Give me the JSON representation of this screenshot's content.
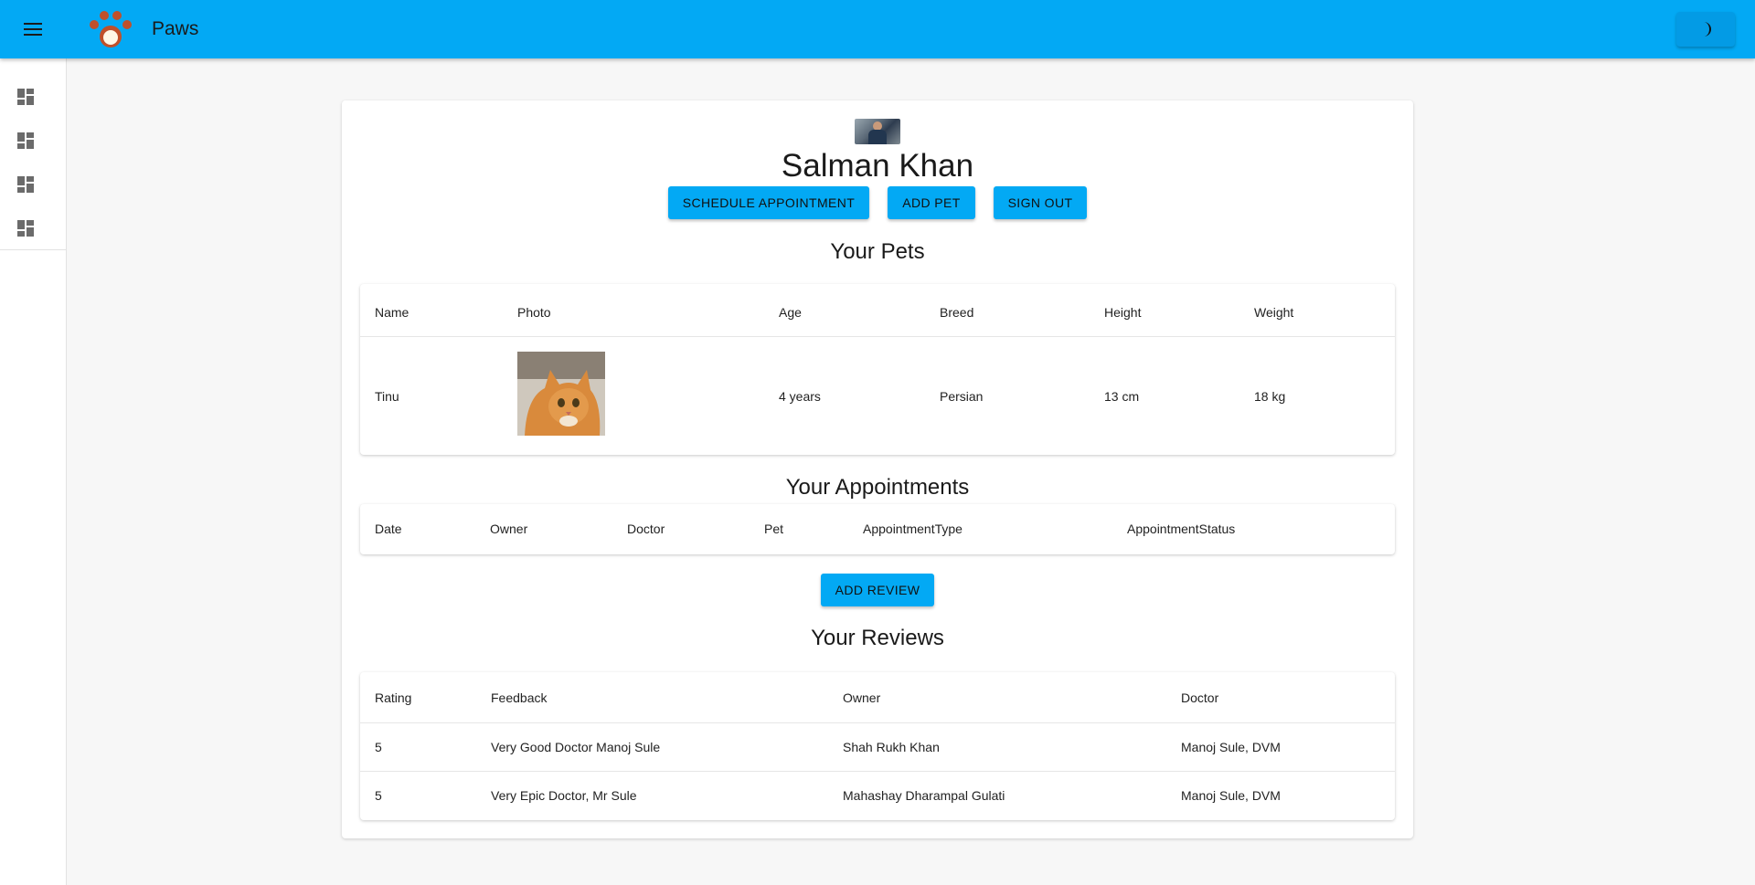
{
  "app": {
    "title": "Paws",
    "menu_icon": "hamburger-menu-icon",
    "theme_icon": "dark-mode-moon-icon"
  },
  "sidebar": {
    "items": [
      {
        "icon": "dashboard-icon"
      },
      {
        "icon": "dashboard-icon"
      },
      {
        "icon": "dashboard-icon"
      },
      {
        "icon": "dashboard-icon"
      }
    ]
  },
  "profile": {
    "name": "Salman Khan",
    "buttons": {
      "schedule": "SCHEDULE APPOINTMENT",
      "add_pet": "ADD PET",
      "sign_out": "SIGN OUT"
    }
  },
  "pets": {
    "title": "Your Pets",
    "headers": [
      "Name",
      "Photo",
      "Age",
      "Breed",
      "Height",
      "Weight"
    ],
    "rows": [
      {
        "name": "Tinu",
        "age": "4 years",
        "breed": "Persian",
        "height": "13 cm",
        "weight": "18 kg"
      }
    ]
  },
  "appointments": {
    "title": "Your Appointments",
    "headers": [
      "Date",
      "Owner",
      "Doctor",
      "Pet",
      "AppointmentType",
      "AppointmentStatus"
    ],
    "add_review_label": "ADD REVIEW"
  },
  "reviews": {
    "title": "Your Reviews",
    "headers": [
      "Rating",
      "Feedback",
      "Owner",
      "Doctor"
    ],
    "rows": [
      {
        "rating": "5",
        "feedback": "Very Good Doctor Manoj Sule",
        "owner": "Shah Rukh Khan",
        "doctor": "Manoj Sule, DVM"
      },
      {
        "rating": "5",
        "feedback": "Very Epic Doctor, Mr Sule",
        "owner": "Mahashay Dharampal Gulati",
        "doctor": "Manoj Sule, DVM"
      }
    ]
  },
  "colors": {
    "primary": "#03a9f4",
    "logo_paw": "#c0502a"
  }
}
